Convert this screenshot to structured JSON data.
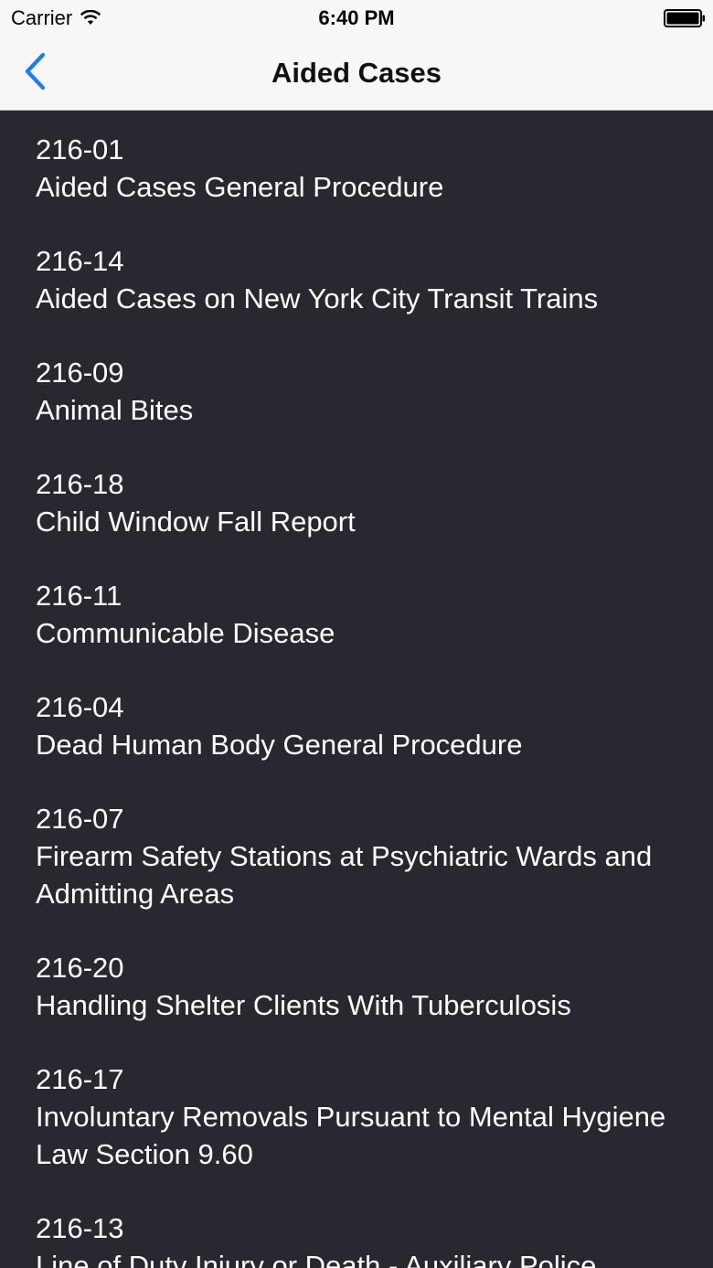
{
  "status_bar": {
    "carrier": "Carrier",
    "time": "6:40 PM",
    "wifi_icon": "wifi-icon",
    "battery_icon": "battery-full-icon"
  },
  "nav": {
    "title": "Aided Cases",
    "back_icon": "chevron-left-icon",
    "accent_color": "#1a7cf7"
  },
  "items": [
    {
      "code": "216-01",
      "title": "Aided Cases General Procedure"
    },
    {
      "code": "216-14",
      "title": "Aided Cases on New York City Transit Trains"
    },
    {
      "code": "216-09",
      "title": "Animal Bites"
    },
    {
      "code": "216-18",
      "title": "Child Window Fall Report"
    },
    {
      "code": "216-11",
      "title": "Communicable Disease"
    },
    {
      "code": "216-04",
      "title": "Dead Human Body General Procedure"
    },
    {
      "code": "216-07",
      "title": "Firearm Safety Stations at Psychiatric Wards and Admitting Areas"
    },
    {
      "code": "216-20",
      "title": "Handling Shelter Clients With Tuberculosis"
    },
    {
      "code": "216-17",
      "title": "Involuntary Removals Pursuant to Mental Hygiene Law Section 9.60"
    },
    {
      "code": "216-13",
      "title": "Line of Duty Injury or Death - Auxiliary Police"
    }
  ],
  "colors": {
    "list_background": "#282830",
    "text": "#ffffff",
    "header_background": "#f7f7f7"
  }
}
